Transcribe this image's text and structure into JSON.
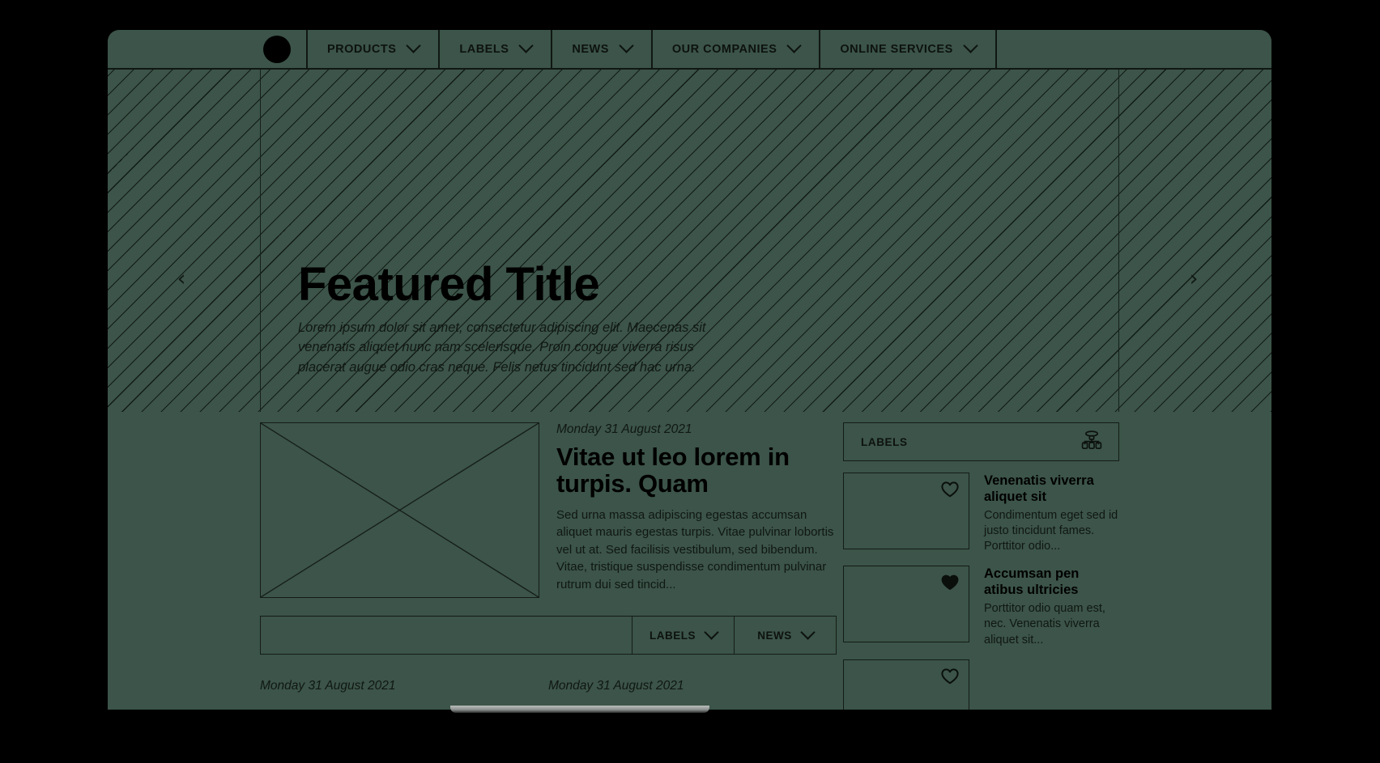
{
  "theme": {
    "page_background": "#000000",
    "screen_background": "#3c5449",
    "ink": "#0d120f"
  },
  "topnav": {
    "logo_name": "logo-dot",
    "items": [
      {
        "label": "PRODUCTS",
        "has_dropdown": true
      },
      {
        "label": "LABELS",
        "has_dropdown": true
      },
      {
        "label": "NEWS",
        "has_dropdown": true
      },
      {
        "label": "OUR COMPANIES",
        "has_dropdown": true
      },
      {
        "label": "ONLINE SERVICES",
        "has_dropdown": true
      }
    ]
  },
  "hero": {
    "title": "Featured Title",
    "subtitle": "Lorem ipsum dolor sit amet, consectetur adipiscing elit. Maecenas sit venenatis aliquet nunc nam scelerisque. Proin congue viverra risus placerat augue odio cras neque. Felis netus tincidunt sed hac urna.",
    "prev_glyph": "‹",
    "next_glyph": "›"
  },
  "feature": {
    "date": "Monday 31 August 2021",
    "title": "Vitae ut leo lorem in turpis. Quam",
    "excerpt": "Sed urna massa adipiscing egestas accumsan aliquet mauris egestas turpis. Vitae pulvinar lobortis vel ut at. Sed facilisis vestibulum, sed bibendum. Vitae, tristique suspendisse condimentum pulvinar rutrum dui sed tincid...",
    "thumb_name": "image-placeholder"
  },
  "filter_bar": {
    "search_value": "",
    "search_placeholder": "",
    "selects": [
      {
        "label": "LABELS"
      },
      {
        "label": "NEWS"
      }
    ]
  },
  "teasers": [
    {
      "date": "Monday 31 August 2021"
    },
    {
      "date": "Monday 31 August 2021"
    }
  ],
  "sidebar": {
    "header": {
      "title": "LABELS",
      "icon": "sitemap-icon"
    },
    "cards": [
      {
        "title": "Venenatis viverra aliquet sit",
        "excerpt": "Condimentum eget sed id justo tincidunt fames. Porttitor odio...",
        "favorite": false,
        "icon": "heart-outline-icon"
      },
      {
        "title": "Accumsan pen atibus ultricies",
        "excerpt": "Porttitor odio quam est, nec. Venenatis viverra aliquet sit...",
        "favorite": true,
        "icon": "heart-filled-icon"
      },
      {
        "title": "",
        "excerpt": "",
        "favorite": false,
        "icon": "heart-outline-icon"
      }
    ]
  }
}
